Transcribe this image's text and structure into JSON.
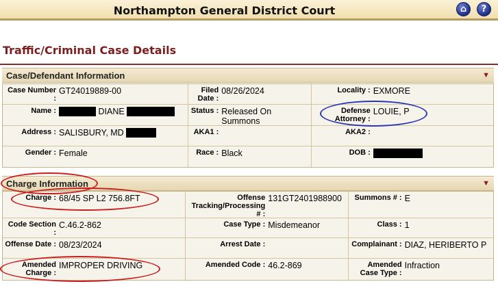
{
  "header": {
    "court_name": "Northampton General District Court",
    "home_glyph": "⌂",
    "help_glyph": "?"
  },
  "page_title": "Traffic/Criminal Case Details",
  "case_section": {
    "title": "Case/Defendant Information",
    "toggle_glyph": "▼",
    "case_number_label": "Case Number :",
    "case_number": "GT24019889-00",
    "filed_label": "Filed Date :",
    "filed_date": "08/26/2024",
    "locality_label": "Locality :",
    "locality": "EXMORE",
    "name_label": "Name :",
    "name_middle": "DIANE",
    "status_label": "Status :",
    "status": "Released On Summons",
    "defense_label": "Defense Attorney :",
    "defense_attorney": "LOUIE, P",
    "address_label": "Address :",
    "address": "SALISBURY, MD",
    "aka1_label": "AKA1 :",
    "aka2_label": "AKA2 :",
    "gender_label": "Gender :",
    "gender": "Female",
    "race_label": "Race :",
    "race": "Black",
    "dob_label": "DOB :"
  },
  "charge_section": {
    "title": "Charge Information",
    "toggle_glyph": "▼",
    "charge_label": "Charge :",
    "charge": "68/45 SP L2 756.8FT",
    "otn_label": "Offense Tracking/Processing # :",
    "otn": "131GT2401988900",
    "summons_label": "Summons # :",
    "summons": "E",
    "code_section_label": "Code Section :",
    "code_section": "C.46.2-862",
    "case_type_label": "Case Type :",
    "case_type": "Misdemeanor",
    "class_label": "Class :",
    "class": "1",
    "offense_date_label": "Offense Date :",
    "offense_date": "08/23/2024",
    "arrest_date_label": "Arrest Date :",
    "complainant_label": "Complainant :",
    "complainant": "DIAZ, HERIBERTO P",
    "amended_charge_label": "Amended Charge :",
    "amended_charge": "IMPROPER DRIVING",
    "amended_code_label": "Amended Code :",
    "amended_code": "46.2-869",
    "amended_case_type_label": "Amended Case Type :",
    "amended_case_type": "Infraction"
  },
  "colors": {
    "title_maroon": "#7a1f1f",
    "annotation_red": "#c81e1e",
    "annotation_blue": "#2b36b3",
    "header_tan": "#f1dfae"
  }
}
